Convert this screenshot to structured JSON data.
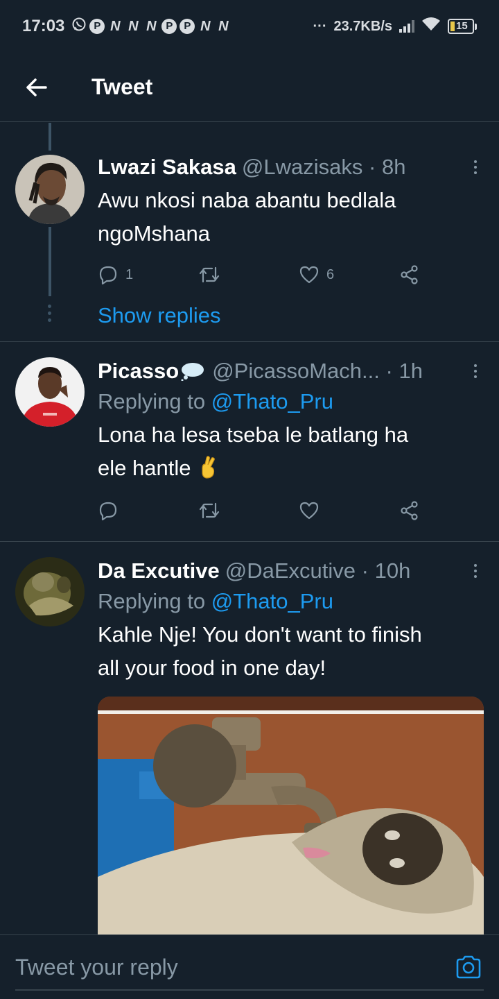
{
  "status_bar": {
    "time": "17:03",
    "notification_glyphs": [
      "P",
      "N",
      "N",
      "N",
      "P",
      "P",
      "N",
      "N"
    ],
    "more": "···",
    "net_speed": "23.7KB/s",
    "battery_level": "15",
    "icons": [
      "whatsapp-icon",
      "signal-icon",
      "wifi-icon",
      "battery-icon"
    ]
  },
  "header": {
    "title": "Tweet",
    "back_icon": "arrow-left-icon"
  },
  "tweets": [
    {
      "name": "Lwazi Sakasa",
      "handle": "@Lwazisaks",
      "separator": "·",
      "time": "8h",
      "text_line1": "Awu nkosi naba abantu bedlala",
      "text_line2": "ngoMshana",
      "reply_count": "1",
      "like_count": "6",
      "show_replies": "Show replies"
    },
    {
      "name": "Picasso",
      "name_emoji": "speech-balloon-icon",
      "handle": "@PicassoMach...",
      "separator": "·",
      "time": "1h",
      "replying_prefix": "Replying to",
      "replying_to": "@Thato_Pru",
      "text_line1": "Lona ha lesa tseba le batlang ha",
      "text_line2": "ele hantle",
      "text_emoji": "crossed-fingers-icon"
    },
    {
      "name": "Da Excutive",
      "handle": "@DaExcutive",
      "separator": "·",
      "time": "10h",
      "replying_prefix": "Replying to",
      "replying_to": "@Thato_Pru",
      "text_line1": "Kahle Nje! You don't want to finish",
      "text_line2": "all your food in one day!",
      "media": "monkey-drinking-from-tap-image"
    }
  ],
  "reply_bar": {
    "placeholder": "Tweet your reply",
    "camera_icon": "camera-icon"
  },
  "colors": {
    "background": "#15202b",
    "divider": "#38444d",
    "accent": "#1d9bf0",
    "secondary_text": "#8899a6"
  }
}
